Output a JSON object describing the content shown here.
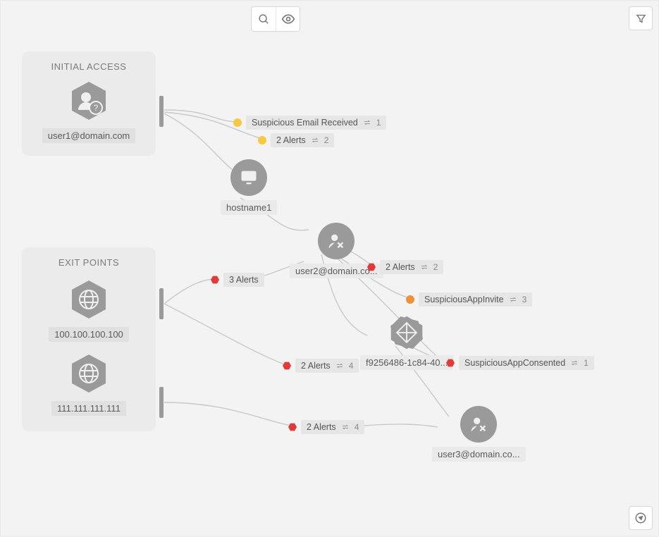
{
  "toolbar": {
    "search": "search",
    "view": "view",
    "filter": "filter",
    "navigate": "navigate"
  },
  "panels": {
    "initial": {
      "title": "INITIAL ACCESS",
      "user": "user1@domain.com"
    },
    "exit": {
      "title": "EXIT POINTS",
      "ips": [
        "100.100.100.100",
        "111.111.111.111"
      ]
    }
  },
  "nodes": {
    "host": "hostname1",
    "user2": "user2@domain.co...",
    "app": "f9256486-1c84-40...",
    "user3": "user3@domain.co..."
  },
  "events": {
    "suspiciousEmail": {
      "label": "Suspicious Email Received",
      "count": "1"
    },
    "alerts2a": {
      "label": "2 Alerts",
      "count": "2"
    },
    "alerts3": {
      "label": "3 Alerts"
    },
    "alerts2b": {
      "label": "2 Alerts",
      "count": "2"
    },
    "appInvite": {
      "label": "SuspiciousAppInvite",
      "count": "3"
    },
    "alerts2c": {
      "label": "2 Alerts",
      "count": "4"
    },
    "appConsented": {
      "label": "SuspiciousAppConsented",
      "count": "1"
    },
    "alerts2d": {
      "label": "2 Alerts",
      "count": "4"
    }
  }
}
